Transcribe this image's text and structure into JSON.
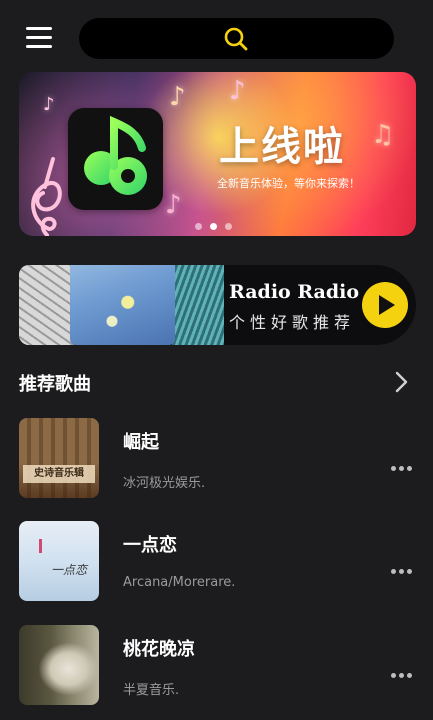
{
  "header": {
    "menu_icon": "hamburger-menu-icon",
    "search_icon": "search-icon",
    "accent_color": "#f5d20f"
  },
  "banner": {
    "title": "上线啦",
    "subtitle": "全新音乐体验，等你来探索！",
    "pages": 3,
    "active_page": 1
  },
  "radio": {
    "title": "Radio Radio",
    "subtitle": "个性好歌推荐",
    "play_icon": "play-icon"
  },
  "section": {
    "title": "推荐歌曲",
    "more_icon": "chevron-right-icon"
  },
  "songs": [
    {
      "title": "崛起",
      "artist": "冰河极光娱乐.",
      "cover_text": "史诗音乐辑"
    },
    {
      "title": "一点恋",
      "artist": "Arcana/Morerare.",
      "cover_text": "一点恋"
    },
    {
      "title": "桃花晚凉",
      "artist": "半夏音乐."
    }
  ]
}
